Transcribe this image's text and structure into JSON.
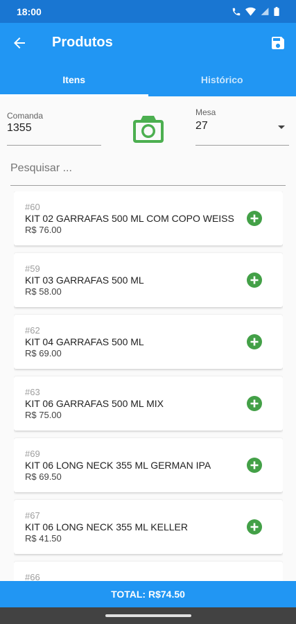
{
  "status_bar": {
    "time": "18:00"
  },
  "app_bar": {
    "title": "Produtos",
    "back_icon": "arrow-back-icon",
    "save_icon": "save-floppy-icon"
  },
  "tabs": [
    {
      "label": "Itens",
      "active": true
    },
    {
      "label": "Histórico",
      "active": false
    }
  ],
  "comanda": {
    "label": "Comanda",
    "value": "1355"
  },
  "mesa": {
    "label": "Mesa",
    "value": "27"
  },
  "camera_icon": "camera-icon",
  "search": {
    "placeholder": "Pesquisar ..."
  },
  "products": [
    {
      "code": "#60",
      "name": "KIT 02 GARRAFAS 500 ML COM COPO WEISS",
      "price": "R$ 76.00"
    },
    {
      "code": "#59",
      "name": "KIT 03 GARRAFAS 500 ML",
      "price": "R$ 58.00"
    },
    {
      "code": "#62",
      "name": "KIT 04 GARRAFAS 500 ML",
      "price": "R$ 69.00"
    },
    {
      "code": "#63",
      "name": "KIT 06 GARRAFAS 500 ML MIX",
      "price": "R$ 75.00"
    },
    {
      "code": "#69",
      "name": "KIT 06 LONG NECK 355 ML GERMAN IPA",
      "price": "R$ 69.50"
    },
    {
      "code": "#67",
      "name": "KIT 06 LONG NECK 355 ML KELLER",
      "price": "R$ 41.50"
    },
    {
      "code": "#66",
      "name": "",
      "price": ""
    }
  ],
  "total": {
    "label": "TOTAL: R$74.50"
  },
  "colors": {
    "primary": "#2196f3",
    "primary_dark": "#1976d2",
    "accent_green": "#43a047",
    "camera_green": "#4caf50"
  }
}
